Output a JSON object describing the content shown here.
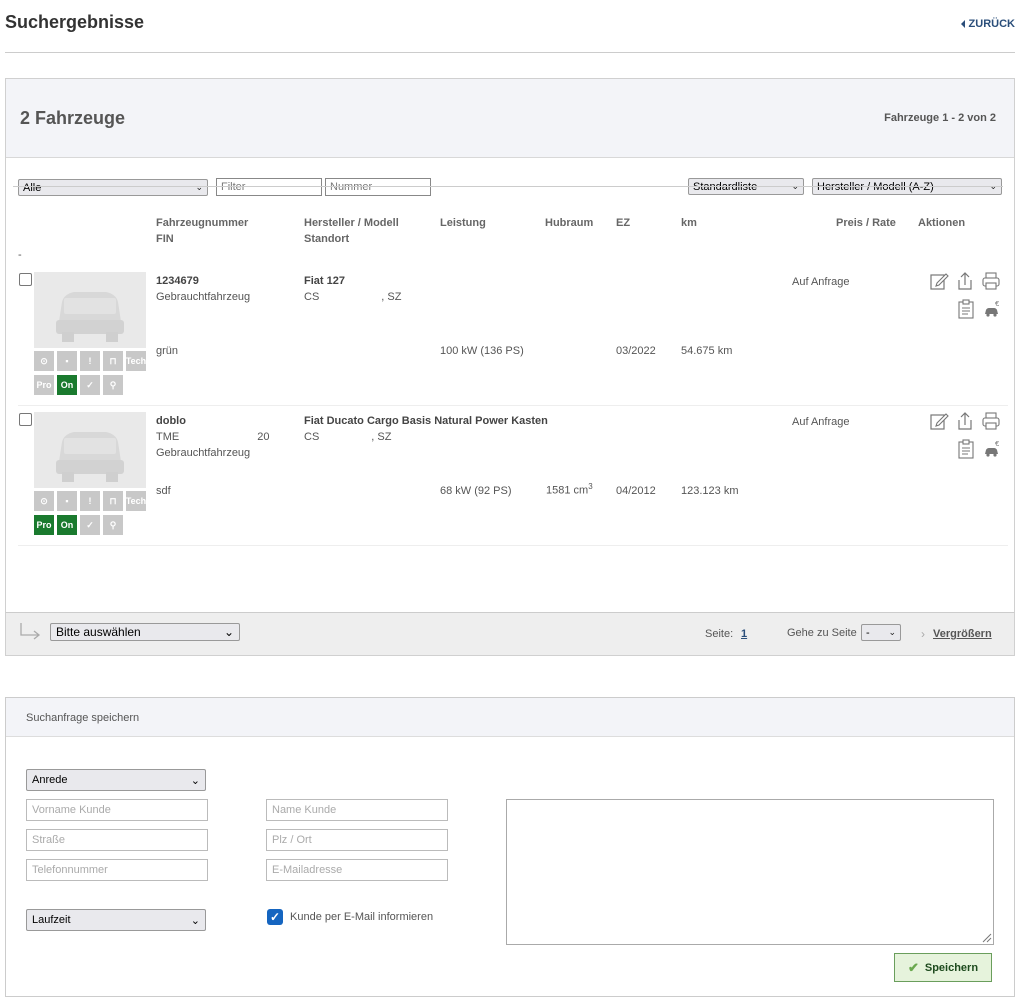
{
  "header": {
    "title": "Suchergebnisse",
    "back_label": "ZURÜCK"
  },
  "results": {
    "title": "2 Fahrzeuge",
    "range_prefix": "Fahrzeuge ",
    "range_bold": "1 - 2",
    "range_suffix": " von 2",
    "filters": {
      "category_value": "Alle",
      "filter_placeholder": "Filter",
      "number_placeholder": "Nummer",
      "list_value": "Standardliste",
      "sort_value": "Hersteller / Modell (A-Z)"
    },
    "columns": {
      "number": "Fahrzeugnummer",
      "fin": "FIN",
      "model": "Hersteller / Modell",
      "location": "Standort",
      "power": "Leistung",
      "displacement": "Hubraum",
      "ez": "EZ",
      "km": "km",
      "price": "Preis / Rate",
      "actions": "Aktionen",
      "dash": "-"
    },
    "vehicles": [
      {
        "number": "1234679",
        "type": "Gebrauchtfahrzeug",
        "color": "grün",
        "model": "Fiat 127",
        "location_a": "CS",
        "location_b": ", SZ",
        "power": "100 kW (136 PS)",
        "ez": "03/2022",
        "km": "54.675 km",
        "price": "Auf Anfrage",
        "badges": [
          "Tech",
          "Pro",
          "On"
        ]
      },
      {
        "number": "doblo",
        "fin_a": "TME",
        "fin_b": "20",
        "type": "Gebrauchtfahrzeug",
        "color": "sdf",
        "model": "Fiat Ducato Cargo Basis Natural Power Kasten",
        "location_a": "CS",
        "location_b": ", SZ",
        "power": "68 kW (92 PS)",
        "displacement": "1581 cm",
        "displacement_sup": "3",
        "ez": "04/2012",
        "km": "123.123 km",
        "price": "Auf Anfrage",
        "badges": [
          "Tech",
          "Pro",
          "On"
        ]
      }
    ],
    "footer": {
      "bulk_select": "Bitte auswählen",
      "page_label": "Seite:",
      "page_number": "1",
      "goto_label": "Gehe zu Seite",
      "goto_value": "-",
      "zoom_label": "Vergrößern"
    }
  },
  "save_search": {
    "title": "Suchanfrage speichern",
    "salutation": "Anrede",
    "first_name": "Vorname Kunde",
    "last_name": "Name Kunde",
    "street": "Straße",
    "zip_city": "Plz / Ort",
    "phone": "Telefonnummer",
    "email": "E-Mailadresse",
    "duration": "Laufzeit",
    "notify_label": "Kunde per E-Mail informieren",
    "save_label": "Speichern"
  }
}
